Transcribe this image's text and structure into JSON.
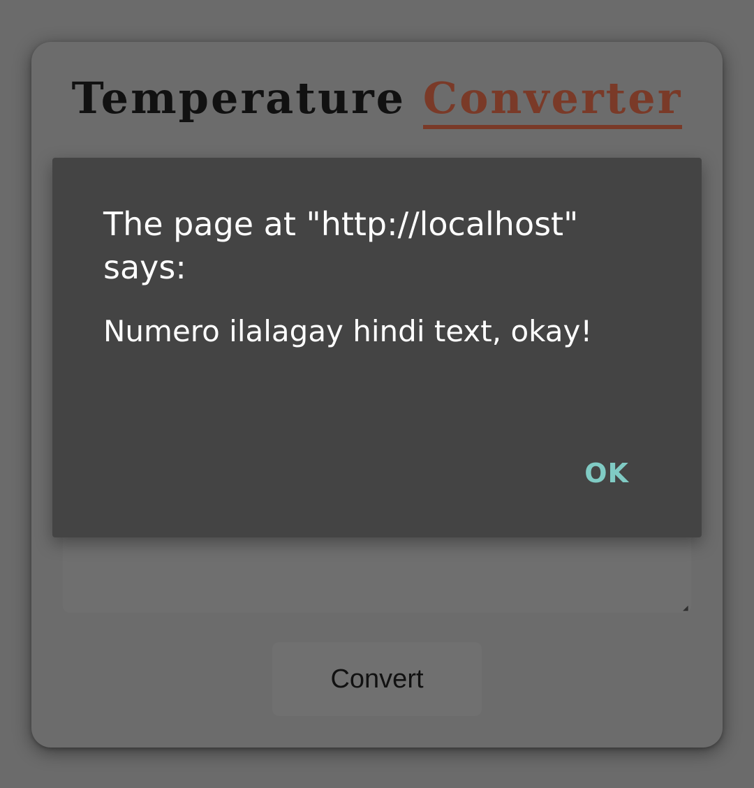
{
  "app": {
    "title_part1": "Temperature",
    "title_part2": "Converter",
    "convert_label": "Convert"
  },
  "dialog": {
    "title": "The page at \"http://localhost\" says:",
    "message": "Numero ilalagay hindi text, okay!",
    "ok_label": "OK"
  },
  "colors": {
    "overlay": "#6b6b6b",
    "dialog_bg": "#444444",
    "title_accent": "#7a3a28",
    "ok_accent": "#80cbc4"
  }
}
